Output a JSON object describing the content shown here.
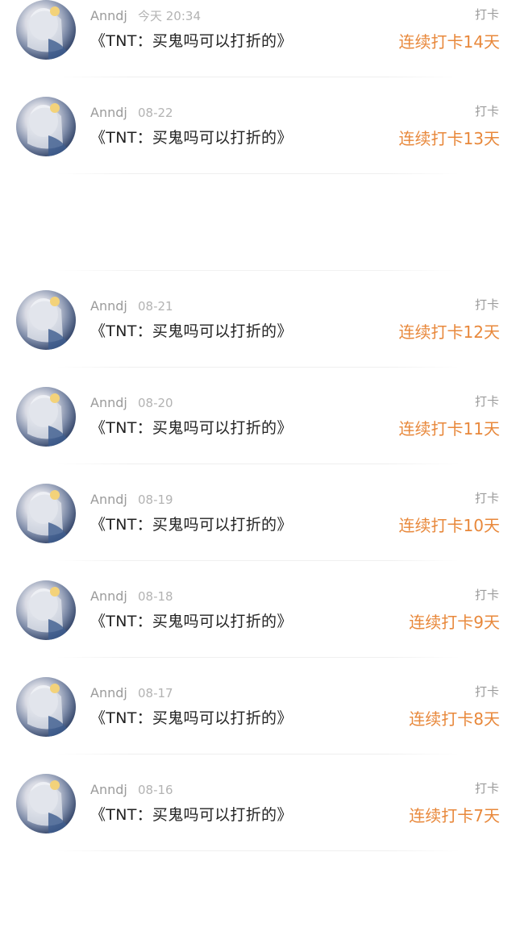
{
  "feed": {
    "items": [
      {
        "username": "Anndj",
        "time": "今天 20:34",
        "title": "《TNT：买鬼吗可以打折的》",
        "tag": "打卡",
        "streak": "连续打卡14天"
      },
      {
        "username": "Anndj",
        "time": "08-22",
        "title": "《TNT：买鬼吗可以打折的》",
        "tag": "打卡",
        "streak": "连续打卡13天"
      },
      {
        "username": "Anndj",
        "time": "08-21",
        "title": "《TNT：买鬼吗可以打折的》",
        "tag": "打卡",
        "streak": "连续打卡12天"
      },
      {
        "username": "Anndj",
        "time": "08-20",
        "title": "《TNT：买鬼吗可以打折的》",
        "tag": "打卡",
        "streak": "连续打卡11天"
      },
      {
        "username": "Anndj",
        "time": "08-19",
        "title": "《TNT：买鬼吗可以打折的》",
        "tag": "打卡",
        "streak": "连续打卡10天"
      },
      {
        "username": "Anndj",
        "time": "08-18",
        "title": "《TNT：买鬼吗可以打折的》",
        "tag": "打卡",
        "streak": "连续打卡9天"
      },
      {
        "username": "Anndj",
        "time": "08-17",
        "title": "《TNT：买鬼吗可以打折的》",
        "tag": "打卡",
        "streak": "连续打卡8天"
      },
      {
        "username": "Anndj",
        "time": "08-16",
        "title": "《TNT：买鬼吗可以打折的》",
        "tag": "打卡",
        "streak": "连续打卡7天"
      }
    ]
  },
  "colors": {
    "streak": "#e8883b",
    "username": "#9b9b9b",
    "title": "#222222"
  }
}
